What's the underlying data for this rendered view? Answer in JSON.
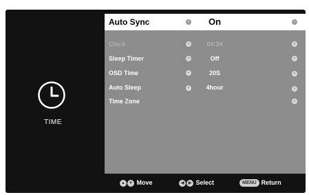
{
  "left": {
    "section_label": "TIME",
    "icon": "clock-icon"
  },
  "menu": {
    "rows": [
      {
        "label": "Auto Sync",
        "value": "On"
      },
      {
        "label": "Clock",
        "value": "04:34"
      },
      {
        "label": "Sleep Timer",
        "value": "Off"
      },
      {
        "label": "OSD Time",
        "value": "20S"
      },
      {
        "label": "Auto Sleep",
        "value": "4hour"
      },
      {
        "label": "Time Zone",
        "value": ""
      }
    ]
  },
  "footer": {
    "move_label": "Move",
    "select_label": "Select",
    "menu_key": "MENU",
    "return_label": "Return"
  }
}
